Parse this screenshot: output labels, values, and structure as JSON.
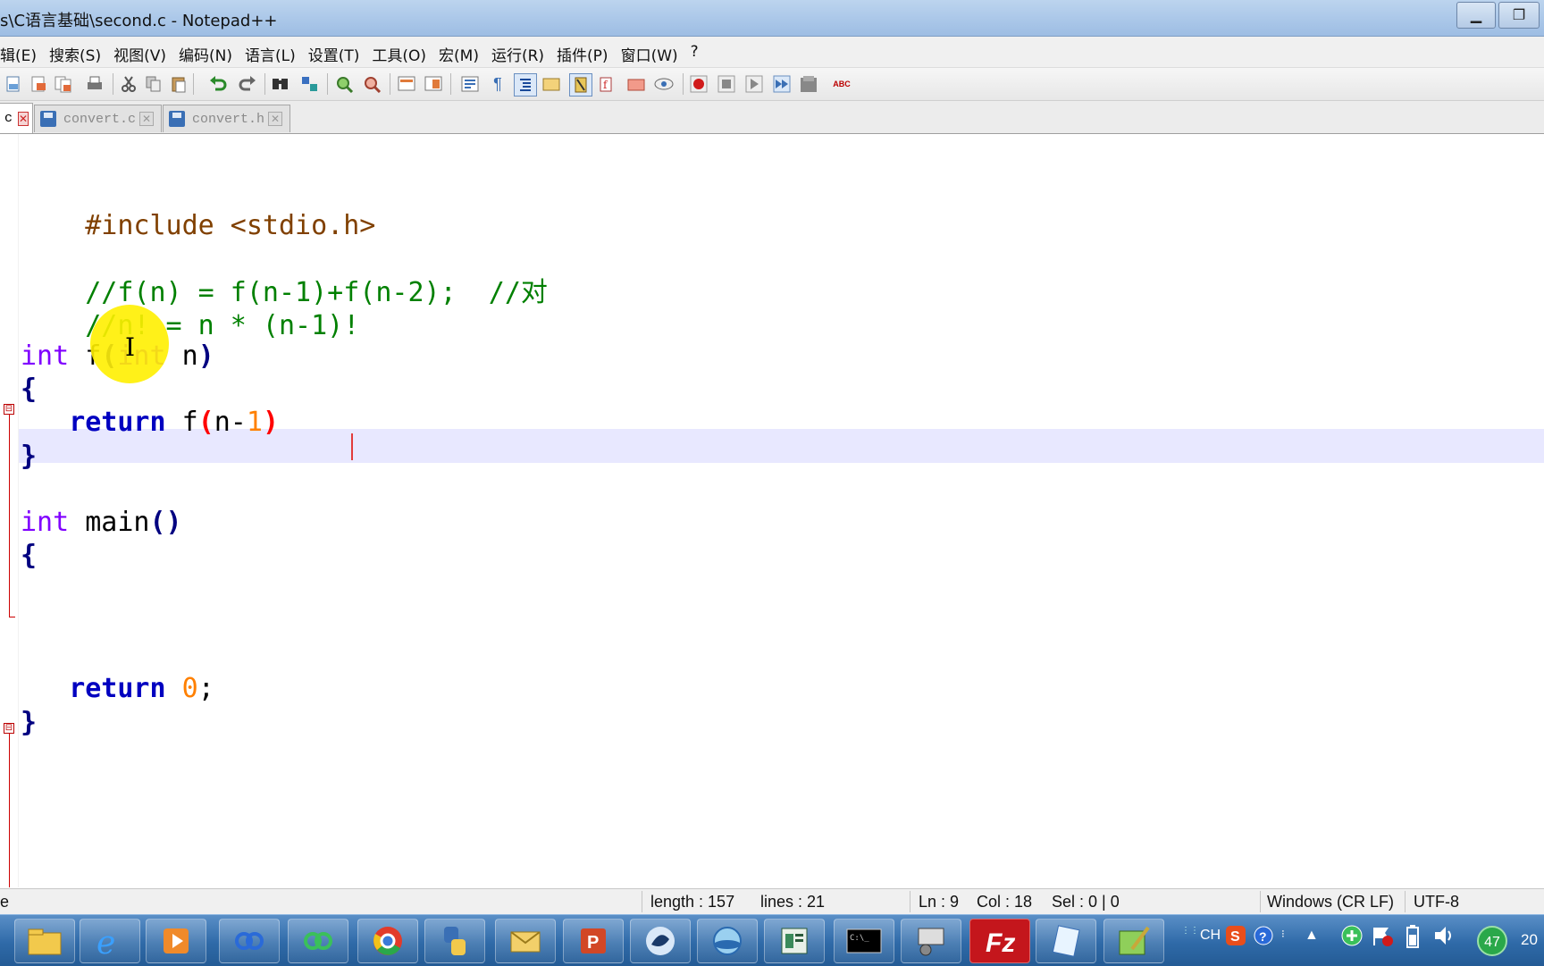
{
  "window": {
    "title": "s\\C语言基础\\second.c - Notepad++",
    "minimize_glyph": "▁",
    "maximize_glyph": "❐"
  },
  "menu": [
    "辑(E)",
    "搜索(S)",
    "视图(V)",
    "编码(N)",
    "语言(L)",
    "设置(T)",
    "工具(O)",
    "宏(M)",
    "运行(R)",
    "插件(P)",
    "窗口(W)",
    "?"
  ],
  "toolbar": {
    "icons": [
      "new-file-icon",
      "open-file-icon",
      "save-icon",
      "save-all-icon",
      "close-icon",
      "close-all-icon",
      "print-icon",
      "cut-icon",
      "copy-icon",
      "paste-icon",
      "undo-icon",
      "redo-icon",
      "find-icon",
      "replace-icon",
      "zoom-in-icon",
      "zoom-out-icon",
      "sync-vertical-icon",
      "sync-horizontal-icon",
      "word-wrap-icon",
      "show-all-chars-icon",
      "indent-guide-icon",
      "user-language-icon",
      "doc-map-icon",
      "function-list-icon",
      "folder-workspace-icon",
      "monitoring-icon",
      "record-macro-icon",
      "stop-record-icon",
      "play-macro-icon",
      "run-macro-multiple-icon",
      "save-macro-icon",
      "spell-check-icon"
    ],
    "spellcheck_label": "ABC"
  },
  "tabs": [
    {
      "label": "c",
      "active": true
    },
    {
      "label": "convert.c",
      "active": false
    },
    {
      "label": "convert.h",
      "active": false
    }
  ],
  "editor": {
    "lines": {
      "include": "#include <stdio.h>",
      "comment1_code": "//f(n) = f(n-1)+f(n-2);  //对",
      "comment2": "//n! = n * (n-1)!",
      "f_type": "int",
      "f_name": " f",
      "f_open": "(",
      "f_param_type": "int",
      "f_param": " n",
      "f_close": ")",
      "brace_open": "{",
      "ret_kw": "return",
      "ret_call": " f",
      "ret_open": "(",
      "ret_n": "n-",
      "ret_one": "1",
      "ret_close": ")",
      "brace_close": "}",
      "main_type": "int",
      "main_name": " main",
      "main_parens": "()",
      "main_open": "{",
      "main_ret_kw": "return",
      "main_ret_zero": "0",
      "main_ret_semi": ";",
      "main_close": "}"
    },
    "fold_glyph": "⊟",
    "ibeam_glyph": "I"
  },
  "status": {
    "mode": "e",
    "length": "length : 157",
    "lines": "lines : 21",
    "ln": "Ln : 9",
    "col": "Col : 18",
    "sel": "Sel : 0 | 0",
    "eol": "Windows (CR LF)",
    "encoding": "UTF-8"
  },
  "taskbar": {
    "apps": [
      "explorer-icon",
      "ie-icon",
      "media-player-icon",
      "baidu-netdisk-icon",
      "green-app-icon",
      "chrome-icon",
      "python-icon",
      "mail-icon",
      "powerpoint-icon",
      "fish-app-icon",
      "network-icon",
      "book-app-icon",
      "cmd-icon",
      "remote-desktop-icon",
      "filezilla-icon",
      "notepad-icon",
      "notepadpp-icon"
    ],
    "tray": {
      "ime": "CH",
      "badge": "47",
      "clock_fragment": "20"
    }
  }
}
